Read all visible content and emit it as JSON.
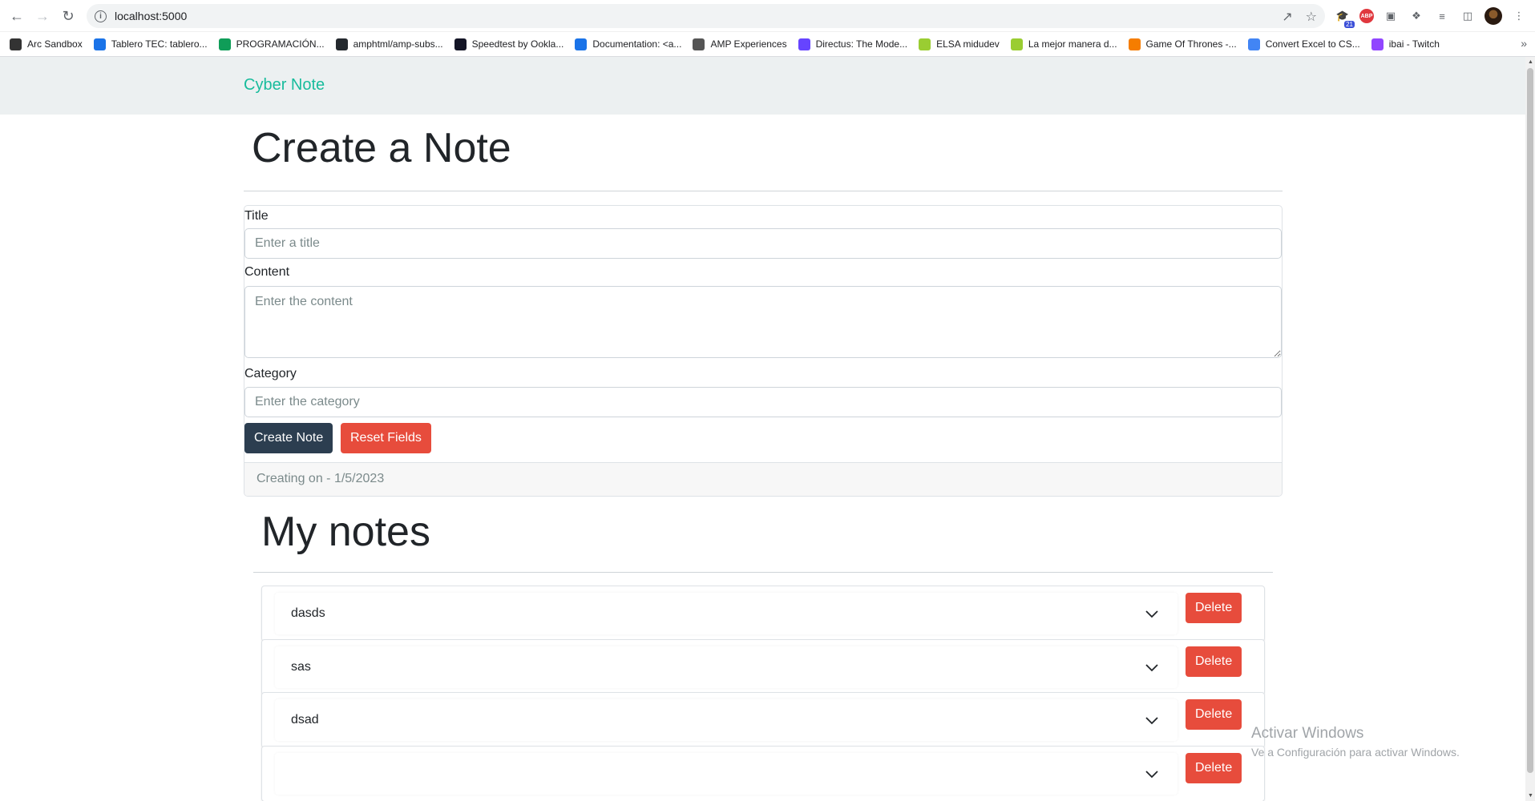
{
  "browser": {
    "url": "localhost:5000",
    "bookmarks": [
      {
        "label": "Arc Sandbox",
        "color": "#333333"
      },
      {
        "label": "Tablero TEC: tablero...",
        "color": "#1a73e8"
      },
      {
        "label": "PROGRAMACIÓN...",
        "color": "#0f9d58"
      },
      {
        "label": "amphtml/amp-subs...",
        "color": "#24292e"
      },
      {
        "label": "Speedtest by Ookla...",
        "color": "#141526"
      },
      {
        "label": "Documentation: <a...",
        "color": "#1a73e8"
      },
      {
        "label": "AMP Experiences",
        "color": "#555555"
      },
      {
        "label": "Directus: The Mode...",
        "color": "#6644ff"
      },
      {
        "label": "ELSA midudev",
        "color": "#9acd32"
      },
      {
        "label": "La mejor manera d...",
        "color": "#9acd32"
      },
      {
        "label": "Game Of Thrones -...",
        "color": "#f57d00"
      },
      {
        "label": "Convert Excel to CS...",
        "color": "#4285f4"
      },
      {
        "label": "ibai - Twitch",
        "color": "#9146ff"
      }
    ],
    "extension_badge": "21",
    "abp_label": "ABP"
  },
  "navbar": {
    "brand": "Cyber Note"
  },
  "form": {
    "heading": "Create a Note",
    "title_label": "Title",
    "title_placeholder": "Enter a title",
    "content_label": "Content",
    "content_placeholder": "Enter the content",
    "category_label": "Category",
    "category_placeholder": "Enter the category",
    "create_button": "Create Note",
    "reset_button": "Reset Fields",
    "footer": "Creating on - 1/5/2023"
  },
  "notes_section": {
    "heading": "My notes",
    "delete_label": "Delete",
    "notes": [
      {
        "title": "dasds"
      },
      {
        "title": "sas"
      },
      {
        "title": "dsad"
      },
      {
        "title": ""
      }
    ]
  },
  "watermark": {
    "line1": "Activar Windows",
    "line2": "Ve a Configuración para activar Windows."
  },
  "colors": {
    "accent": "#18bc9c",
    "primary_dark": "#2c3e50",
    "danger": "#e74c3c",
    "navbar_bg": "#ecf0f1"
  }
}
